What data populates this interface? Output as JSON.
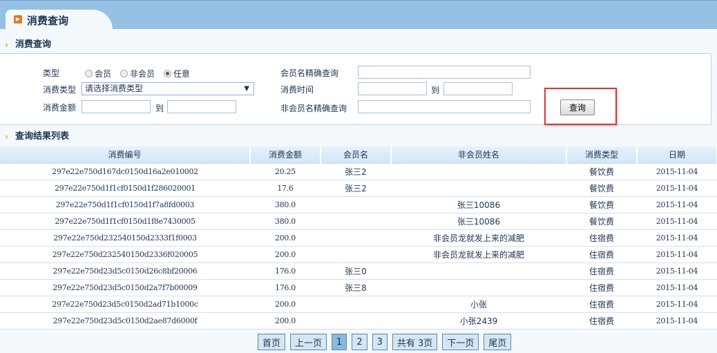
{
  "tab_title": "消费查询",
  "section_query": "消费查询",
  "section_results": "查询结果列表",
  "form": {
    "type_label": "类型",
    "radios": [
      {
        "label": "会员",
        "checked": false
      },
      {
        "label": "非会员",
        "checked": false
      },
      {
        "label": "任意",
        "checked": true
      }
    ],
    "consume_type_label": "消费类型",
    "consume_type_value": "请选择消费类型",
    "amount_label": "消费金额",
    "to_label": "到",
    "member_name_label": "会员名精确查询",
    "time_label": "消费时间",
    "nonmember_name_label": "非会员名精确查询",
    "query_button": "查询"
  },
  "table": {
    "headers": [
      "消费编号",
      "消费金额",
      "会员名",
      "非会员姓名",
      "消费类型",
      "日期"
    ],
    "rows": [
      [
        "297e22e750d167dc0150d16a2e010002",
        "20.25",
        "张三2",
        "",
        "餐饮费",
        "2015-11-04"
      ],
      [
        "297e22e750d1f1cf0150d1f286020001",
        "17.6",
        "张三2",
        "",
        "餐饮费",
        "2015-11-04"
      ],
      [
        "297e22e750d1f1cf0150d1f7a8fd0003",
        "380.0",
        "",
        "张三10086",
        "餐饮费",
        "2015-11-04"
      ],
      [
        "297e22e750d1f1cf0150d1f8e7430005",
        "380.0",
        "",
        "张三10086",
        "餐饮费",
        "2015-11-04"
      ],
      [
        "297e22e750d232540150d2333f1f0003",
        "200.0",
        "",
        "非会员龙就发上来的减肥",
        "住宿费",
        "2015-11-04"
      ],
      [
        "297e22e750d232540150d2336f020005",
        "200.0",
        "",
        "非会员龙就发上来的减肥",
        "住宿费",
        "2015-11-04"
      ],
      [
        "297e22e750d23d5c0150d26c8bf20006",
        "176.0",
        "张三0",
        "",
        "住宿费",
        "2015-11-04"
      ],
      [
        "297e22e750d23d5c0150d2a7f7b00009",
        "176.0",
        "张三8",
        "",
        "住宿费",
        "2015-11-04"
      ],
      [
        "297e22e750d23d5c0150d2ad71b1000c",
        "200.0",
        "",
        "小张",
        "住宿费",
        "2015-11-04"
      ],
      [
        "297e22e750d23d5c0150d2ae87d6000f",
        "200.0",
        "",
        "小张2439",
        "住宿费",
        "2015-11-04"
      ]
    ]
  },
  "pager": {
    "first": "首页",
    "prev": "上一页",
    "pages": [
      "1",
      "2",
      "3"
    ],
    "current": "1",
    "total": "共有  3页",
    "next": "下一页",
    "last": "尾页"
  }
}
